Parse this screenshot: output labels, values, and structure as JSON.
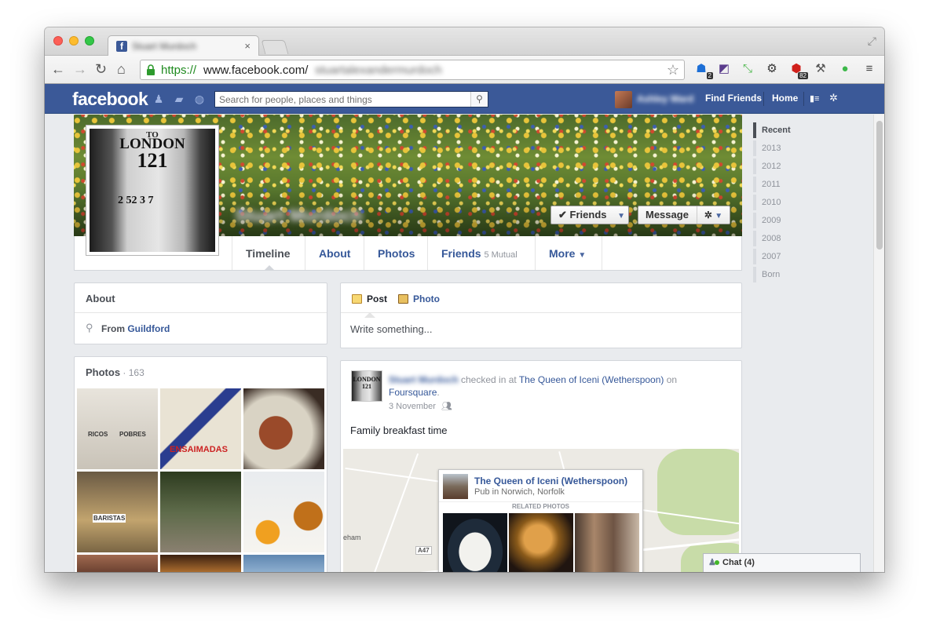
{
  "browser": {
    "tab_title": "Stuart Murdoch",
    "url_scheme": "https://",
    "url_host": "www.facebook.com/",
    "url_path": "stuartalexandermurdoch",
    "ext_badges": {
      "ghostery": "2",
      "adblock": "82"
    }
  },
  "fb_header": {
    "logo": "facebook",
    "search_placeholder": "Search for people, places and things",
    "user_name": "Ashley Ward",
    "find_friends": "Find Friends",
    "home": "Home",
    "brand_color": "#3b5998"
  },
  "profile": {
    "name": "Stuart Murdoch",
    "picture_text": [
      "TO",
      "LONDON",
      "121",
      "2 52 3 7"
    ],
    "buttons": {
      "friends": "Friends",
      "message": "Message"
    },
    "tabs": {
      "timeline": "Timeline",
      "about": "About",
      "photos": "Photos",
      "friends": "Friends",
      "friends_mutual": "5 Mutual",
      "more": "More"
    }
  },
  "about_card": {
    "title": "About",
    "from_prefix": "From ",
    "from_city": "Guildford"
  },
  "photos_card": {
    "title": "Photos",
    "count": " · 163",
    "photo_labels": [
      "RICOS",
      "POBRES",
      "ENSAIMADAS",
      "BARISTAS"
    ]
  },
  "composer": {
    "post": "Post",
    "photo": "Photo",
    "placeholder": "Write something..."
  },
  "story": {
    "avatar_text": "LONDON 121",
    "author": "Stuart Murdoch",
    "verb": " checked in at ",
    "place": "The Queen of Iceni (Wetherspoon)",
    "on": " on ",
    "app": "Foursquare",
    "period": ".",
    "date": "3 November",
    "text": "Family breakfast time",
    "map_place": "eham",
    "map_road": "A47",
    "place_card": {
      "name": "The Queen of Iceni (Wetherspoon)",
      "category": "Pub in Norwich, Norfolk",
      "related": "RELATED PHOTOS"
    }
  },
  "timeline_nav": [
    "Recent",
    "2013",
    "2012",
    "2011",
    "2010",
    "2009",
    "2008",
    "2007",
    "Born"
  ],
  "chat": {
    "label": "Chat (4)"
  }
}
